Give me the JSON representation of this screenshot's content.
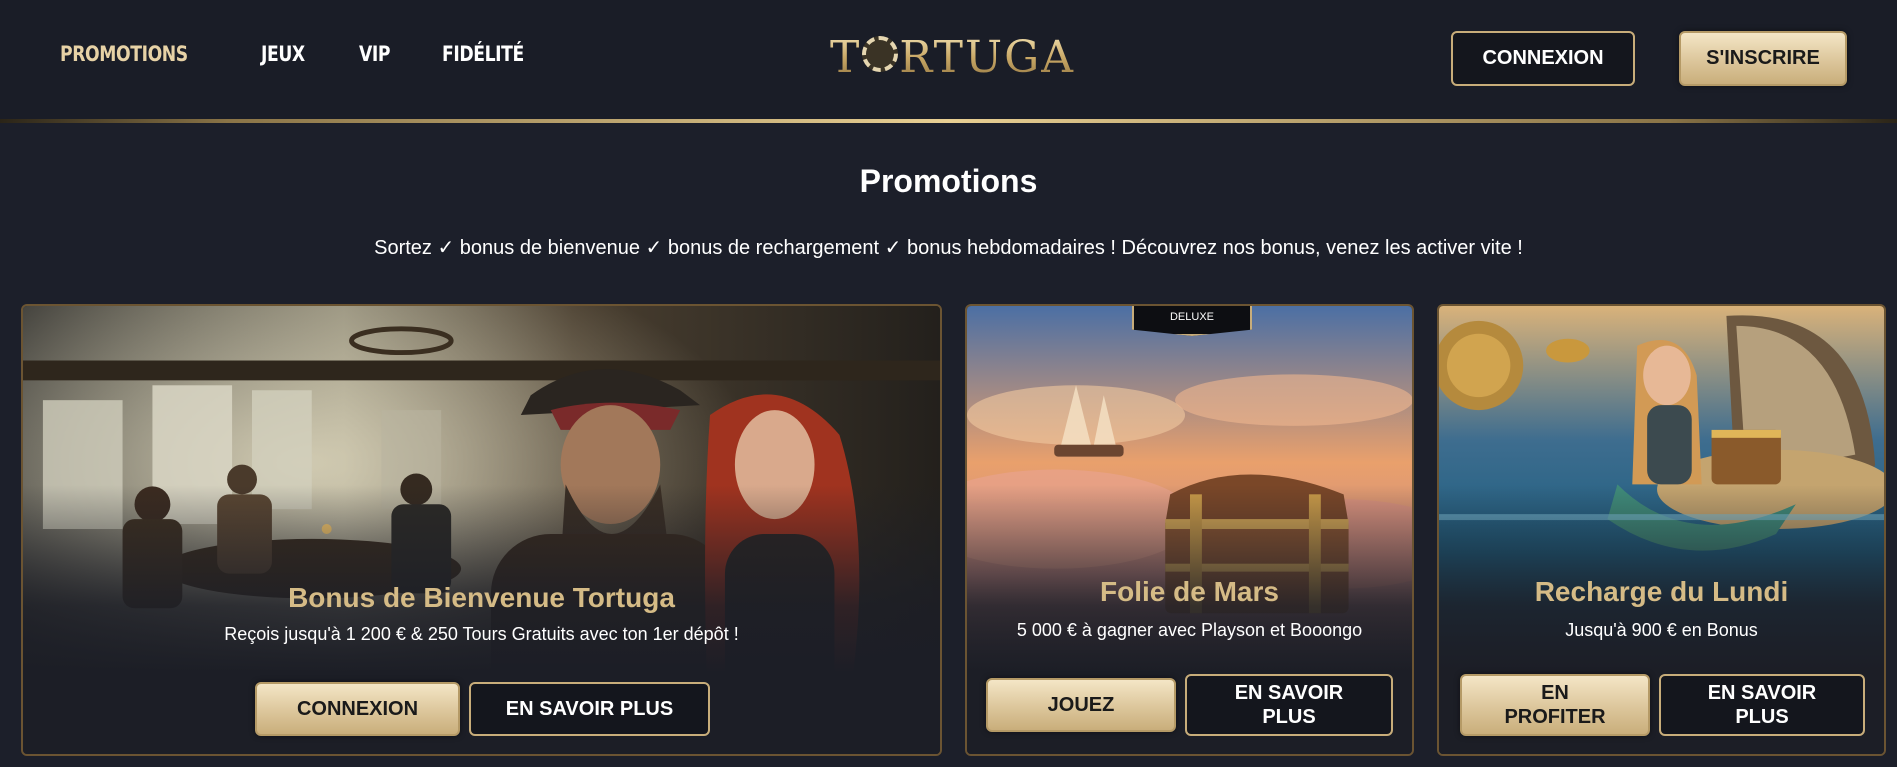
{
  "header": {
    "nav": [
      "PROMOTIONS",
      "JEUX",
      "VIP",
      "FIDÉLITÉ"
    ],
    "logo_left": "T",
    "logo_right": "RTUGA",
    "login_label": "CONNEXION",
    "signup_label": "S'INSCRIRE"
  },
  "main": {
    "title": "Promotions",
    "subtitle": "Sortez ✓ bonus de bienvenue ✓ bonus de rechargement ✓ bonus hebdomadaires ! Découvrez nos bonus, venez les activer vite !"
  },
  "cards": [
    {
      "title": "Bonus de Bienvenue Tortuga",
      "desc": "Reçois jusqu'à 1 200 € & 250 Tours Gratuits avec ton 1er dépôt !",
      "primary": "CONNEXION",
      "secondary": "EN SAVOIR PLUS"
    },
    {
      "badge": "DELUXE",
      "title": "Folie de Mars",
      "desc": "5 000 € à gagner avec Playson et Booongo",
      "primary": "JOUEZ",
      "secondary": "EN SAVOIR PLUS"
    },
    {
      "title": "Recharge du Lundi",
      "desc": "Jusqu'à 900 € en Bonus",
      "primary": "EN PROFITER",
      "secondary": "EN SAVOIR PLUS"
    }
  ],
  "colors": {
    "background": "#1c1f2a",
    "gold": "#d5bb86",
    "gold_button": "#dcc69b",
    "border": "#c8ad7a"
  }
}
